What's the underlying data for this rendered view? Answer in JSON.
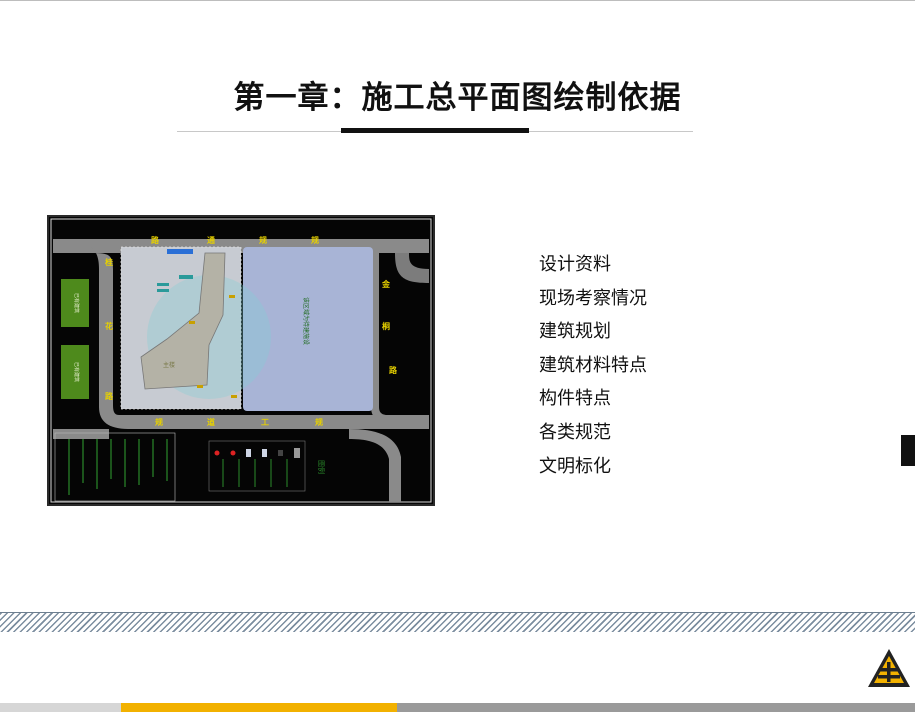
{
  "slide": {
    "title": "第一章：施工总平面图绘制依据",
    "bullets": [
      "设计资料",
      "现场考察情况",
      "建筑规划",
      "建筑材料特点",
      "构件特点",
      "各类规范",
      "文明标化"
    ]
  },
  "plan_image": {
    "road_top": [
      "路",
      "通",
      "规",
      "规"
    ],
    "road_left": [
      "桂",
      "花",
      "路"
    ],
    "road_right": [
      "金",
      "桐",
      "路"
    ],
    "road_bottom": [
      "规",
      "道",
      "工",
      "规"
    ],
    "existing_building_label_1": "已有建筑",
    "existing_building_label_2": "已有建筑",
    "right_zone_label": "该区域为待建施设",
    "legend_title": "图例"
  },
  "colors": {
    "accent_yellow": "#f2b100",
    "plan_background": "#050505",
    "road_gray": "#8a8a8a",
    "site_lavender": "#a8b4d6",
    "green_block": "#4e8a1c"
  },
  "logo_icon": "company-logo-icon"
}
